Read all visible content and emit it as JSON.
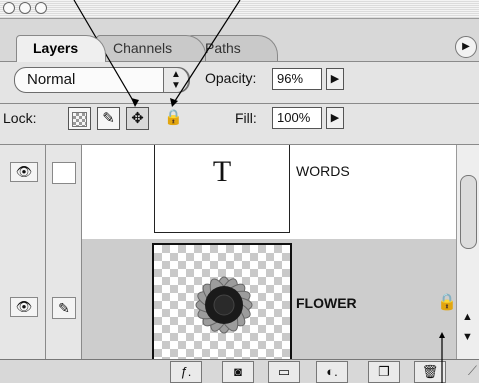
{
  "tabs": [
    {
      "label": "Layers",
      "active": true
    },
    {
      "label": "Channels",
      "active": false
    },
    {
      "label": "Paths",
      "active": false
    }
  ],
  "blend_mode": {
    "value": "Normal"
  },
  "opacity": {
    "label": "Opacity:",
    "value": "96%"
  },
  "lock": {
    "label": "Lock:"
  },
  "fill": {
    "label": "Fill:",
    "value": "100%"
  },
  "layers": [
    {
      "name": "WORDS",
      "thumb_text": "T",
      "visible": true,
      "type": "text"
    },
    {
      "name": "FLOWER",
      "visible": true,
      "locked": true,
      "selected": true
    }
  ],
  "icons": {
    "lock_transparent": "checker-icon",
    "lock_image": "brush-icon",
    "lock_position": "move-icon",
    "lock_all": "lock-icon",
    "bottom": [
      "layer-style-icon",
      "mask-icon",
      "folder-icon",
      "adjustment-icon",
      "new-layer-icon",
      "trash-icon"
    ]
  },
  "colors": {
    "selected_row": "#cdcdcd",
    "panel_bg": "#e4e4e4"
  }
}
